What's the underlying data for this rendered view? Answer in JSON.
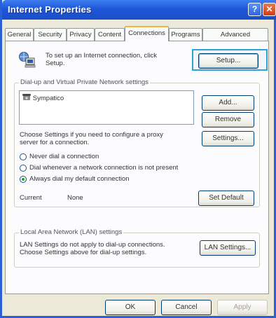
{
  "window": {
    "title": "Internet Properties",
    "help_glyph": "?",
    "close_glyph": "✕"
  },
  "tabs": [
    {
      "label": "General"
    },
    {
      "label": "Security"
    },
    {
      "label": "Privacy"
    },
    {
      "label": "Content"
    },
    {
      "label": "Connections",
      "active": true
    },
    {
      "label": "Programs"
    },
    {
      "label": "Advanced"
    }
  ],
  "setup": {
    "text_line1": "To set up an Internet connection, click",
    "text_line2": "Setup.",
    "button": "Setup..."
  },
  "dialup": {
    "group_label": "Dial-up and Virtual Private Network settings",
    "list_items": [
      "Sympatico"
    ],
    "add_button": "Add...",
    "remove_button": "Remove",
    "proxy_text_line1": "Choose Settings if you need to configure a proxy",
    "proxy_text_line2": "server for a connection.",
    "settings_button": "Settings...",
    "radios": [
      {
        "label": "Never dial a connection",
        "checked": false
      },
      {
        "label": "Dial whenever a network connection is not present",
        "checked": false
      },
      {
        "label": "Always dial my default connection",
        "checked": true
      }
    ],
    "current_label": "Current",
    "current_value": "None",
    "set_default_button": "Set Default"
  },
  "lan": {
    "group_label": "Local Area Network (LAN) settings",
    "text_line1": "LAN Settings do not apply to dial-up connections.",
    "text_line2": "Choose Settings above for dial-up settings.",
    "button": "LAN Settings..."
  },
  "footer": {
    "ok": "OK",
    "cancel": "Cancel",
    "apply": "Apply"
  },
  "colors": {
    "titlebar": "#1e56d9",
    "highlight": "#2ea3d8",
    "active_tab_accent": "#f3b53a"
  }
}
